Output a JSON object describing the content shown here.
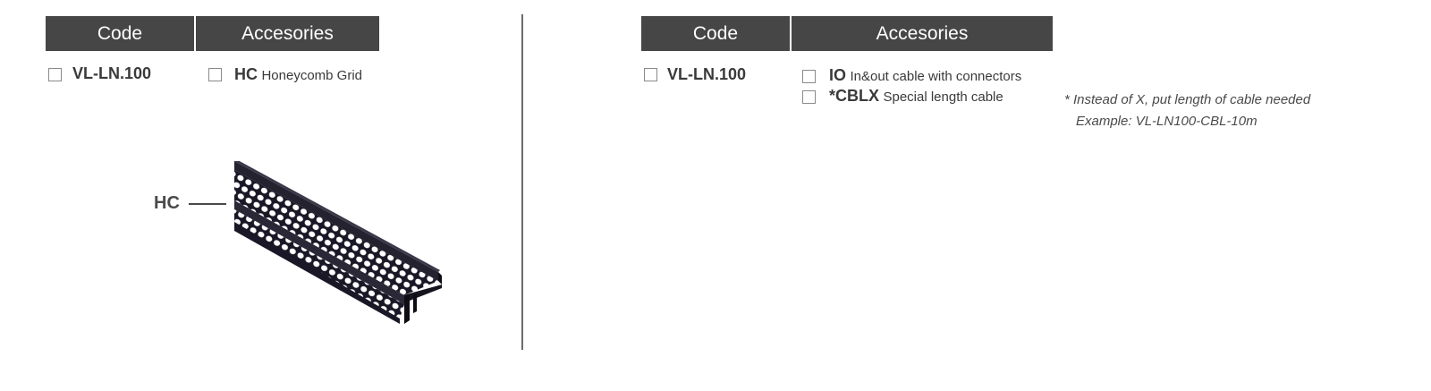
{
  "left_table": {
    "header_code": "Code",
    "header_accessories": "Accesories",
    "code": "VL-LN.100",
    "accessory_code": "HC",
    "accessory_desc": "Honeycomb Grid"
  },
  "illustration": {
    "callout_label": "HC",
    "icon": "honeycomb-grid-icon"
  },
  "right_table": {
    "header_code": "Code",
    "header_accessories": "Accesories",
    "code": "VL-LN.100",
    "accessories": [
      {
        "code": "IO",
        "desc": "In&out cable with connectors"
      },
      {
        "code": "*CBLX",
        "desc": "Special length cable"
      }
    ]
  },
  "note": {
    "line1": "* Instead of X, put length of cable needed",
    "line2": "Example:  VL-LN100-CBL-10m"
  },
  "colors": {
    "header_bg": "#464646",
    "header_text": "#ffffff",
    "text": "#3a3a3a",
    "product": "#1a1826"
  }
}
